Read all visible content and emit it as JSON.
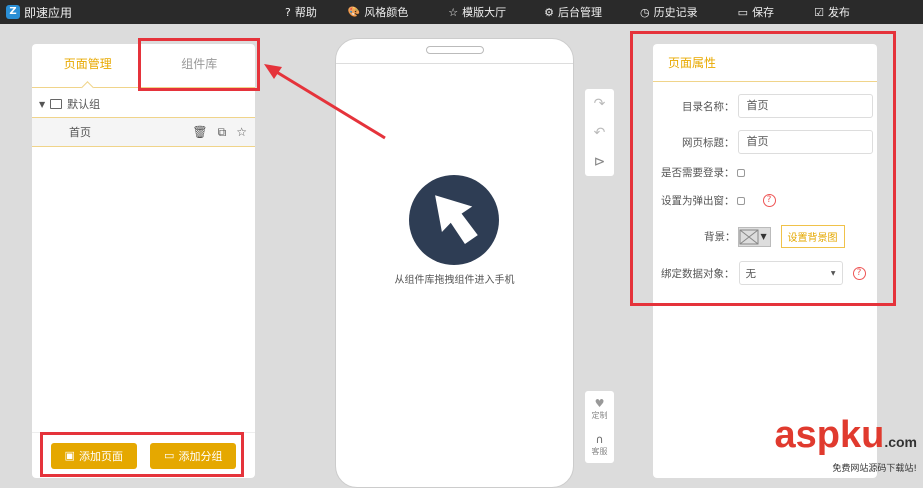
{
  "app": {
    "title": "即速应用",
    "logo_letter": "Z"
  },
  "nav": [
    {
      "label": "帮助",
      "icon": "help-circle-icon",
      "glyph": "?"
    },
    {
      "label": "风格颜色",
      "icon": "palette-icon",
      "glyph": "🎨"
    },
    {
      "label": "模版大厅",
      "icon": "star-icon",
      "glyph": "☆"
    },
    {
      "label": "后台管理",
      "icon": "gear-icon",
      "glyph": "⚙"
    },
    {
      "label": "历史记录",
      "icon": "history-icon",
      "glyph": "◷"
    },
    {
      "label": "保存",
      "icon": "save-icon",
      "glyph": "▭"
    },
    {
      "label": "发布",
      "icon": "publish-icon",
      "glyph": "☑"
    }
  ],
  "left": {
    "tabs": [
      "页面管理",
      "组件库"
    ],
    "group": "默认组",
    "page": "首页",
    "buttons": {
      "add_page": "添加页面",
      "add_group": "添加分组"
    }
  },
  "phone": {
    "hint": "从组件库拖拽组件进入手机"
  },
  "tools": {
    "customize": "定制",
    "service": "客服"
  },
  "props": {
    "title": "页面属性",
    "dir_name_label": "目录名称：",
    "dir_name": "首页",
    "page_title_label": "网页标题：",
    "page_title": "首页",
    "login_label": "是否需要登录：",
    "popup_label": "设置为弹出窗：",
    "bg_label": "背景：",
    "bg_button": "设置背景图",
    "bind_label": "绑定数据对象：",
    "bind_value": "无"
  },
  "watermark": {
    "brand": "aspku",
    "domain": ".com",
    "tagline": "免费网站源码下载站!"
  }
}
